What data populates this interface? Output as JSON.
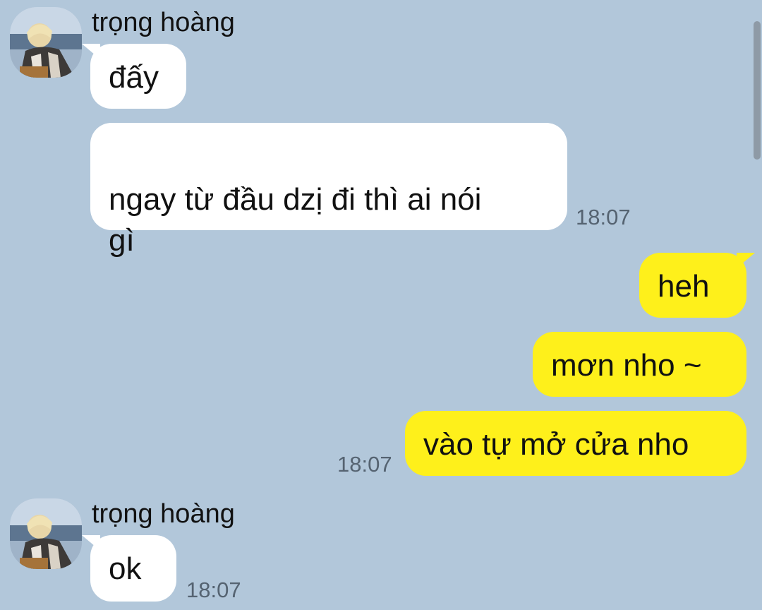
{
  "chat": {
    "group1": {
      "sender": "trọng hoàng",
      "avatar_icon": "profile-photo",
      "messages": [
        "đấy",
        "ngay từ đầu dzị đi thì ai nói\ngì"
      ],
      "time": "18:07"
    },
    "outgoing": {
      "messages": [
        "heh",
        "mơn nho ~",
        "vào tự mở cửa nho"
      ],
      "time": "18:07"
    },
    "group2": {
      "sender": "trọng hoàng",
      "avatar_icon": "profile-photo",
      "messages": [
        "ok"
      ],
      "time": "18:07"
    }
  },
  "colors": {
    "background": "#b2c7da",
    "incoming_bubble": "#ffffff",
    "outgoing_bubble": "#fef01b",
    "timestamp": "#556371"
  }
}
